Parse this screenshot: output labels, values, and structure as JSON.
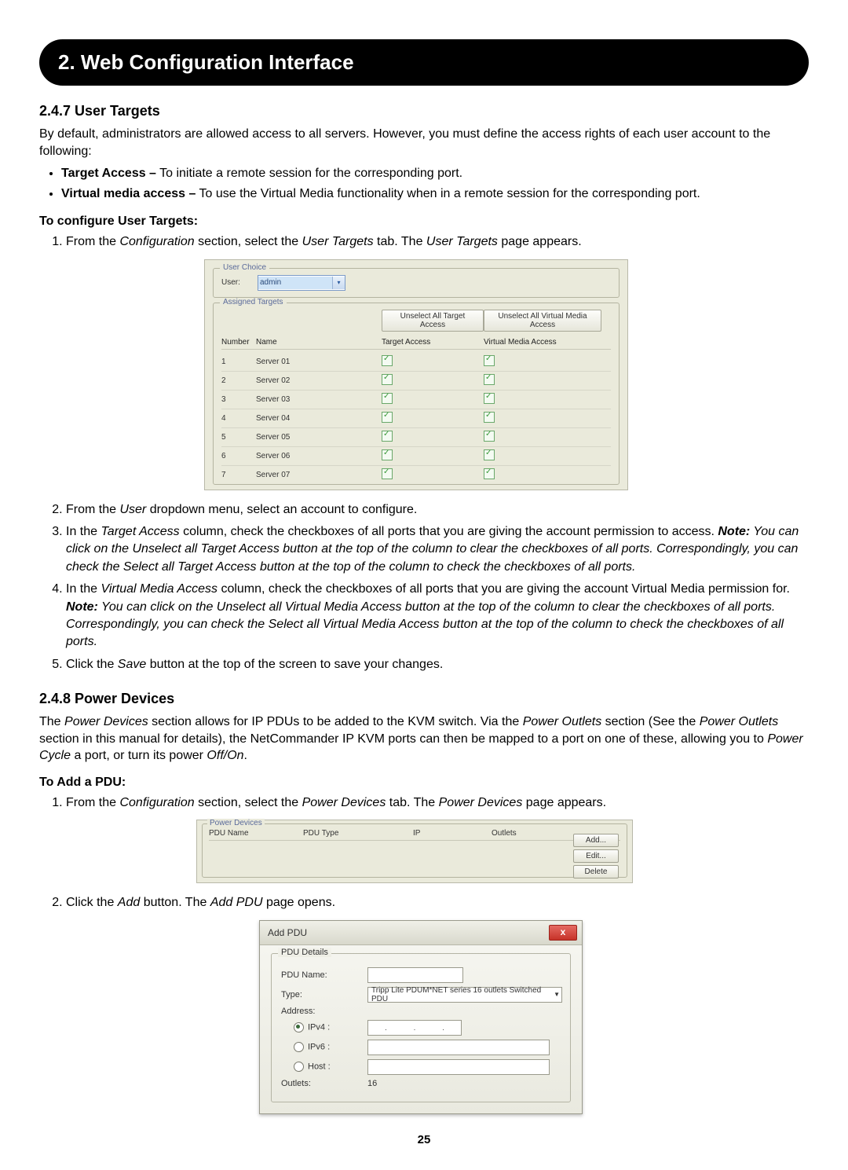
{
  "chapter_title": "2. Web Configuration Interface",
  "s247": {
    "heading": "2.4.7 User Targets",
    "intro": "By default, administrators are allowed access to all servers. However, you must define the access rights of each user account to the following:",
    "bullet1_bold": "Target Access –",
    "bullet1_text": " To initiate a remote session for the corresponding port.",
    "bullet2_bold": "Virtual media access –",
    "bullet2_text": " To use the Virtual Media functionality when in a remote session for the corresponding port.",
    "configure_head": "To configure User Targets:",
    "step1_a": "From the ",
    "step1_b": "Configuration",
    "step1_c": " section, select the ",
    "step1_d": "User Targets",
    "step1_e": " tab. The ",
    "step1_f": "User Targets",
    "step1_g": " page appears."
  },
  "ut_shot": {
    "user_choice_legend": "User Choice",
    "user_label": "User:",
    "user_value": "admin",
    "assigned_legend": "Assigned Targets",
    "btn_unselect_target": "Unselect All Target Access",
    "btn_unselect_virtual": "Unselect All Virtual Media Access",
    "col_number": "Number",
    "col_name": "Name",
    "col_target": "Target Access",
    "col_virtual": "Virtual Media Access",
    "rows": [
      {
        "num": "1",
        "name": "Server 01"
      },
      {
        "num": "2",
        "name": "Server 02"
      },
      {
        "num": "3",
        "name": "Server 03"
      },
      {
        "num": "4",
        "name": "Server 04"
      },
      {
        "num": "5",
        "name": "Server 05"
      },
      {
        "num": "6",
        "name": "Server 06"
      },
      {
        "num": "7",
        "name": "Server 07"
      }
    ]
  },
  "steps_after": {
    "s2_a": "From the ",
    "s2_b": "User",
    "s2_c": " dropdown menu, select an account to configure.",
    "s3_a": "In the ",
    "s3_b": "Target Access",
    "s3_c": " column, check the checkboxes of all ports that you are giving the account permission to access. ",
    "s3_note_b": "Note:",
    "s3_note": " You can click on the Unselect all Target Access button at the top of the column to clear the checkboxes of all ports. Correspondingly, you can check the Select all Target Access button at the top of the column to check the checkboxes of all ports.",
    "s4_a": "In the ",
    "s4_b": "Virtual Media Access",
    "s4_c": " column, check the checkboxes of all ports that you are giving the account Virtual Media permission for. ",
    "s4_note_b": "Note:",
    "s4_note": " You can click on the Unselect all Virtual Media Access button at the top of the column to clear the checkboxes of all ports. Correspondingly, you can check the Select all Virtual Media Access button at the top of the column to check the checkboxes of all ports.",
    "s5_a": "Click the ",
    "s5_b": "Save",
    "s5_c": " button at the top of the screen to save your changes."
  },
  "s248": {
    "heading": "2.4.8 Power Devices",
    "para_a": "The ",
    "para_b": "Power Devices",
    "para_c": " section allows for IP PDUs to be added to the KVM switch. Via the ",
    "para_d": "Power Outlets",
    "para_e": " section (See the ",
    "para_f": "Power Outlets",
    "para_g": " section in this manual for details), the NetCommander IP KVM ports can then be mapped to a port on one of these, allowing you to ",
    "para_h": "Power Cycle",
    "para_i": " a port, or turn its power ",
    "para_j": "Off/On",
    "para_k": ".",
    "add_head": "To Add a PDU:",
    "step1_a": "From the ",
    "step1_b": "Configuration",
    "step1_c": " section, select the ",
    "step1_d": "Power Devices",
    "step1_e": " tab. The ",
    "step1_f": "Power Devices",
    "step1_g": " page appears."
  },
  "pd_shot": {
    "legend": "Power Devices",
    "col_name": "PDU Name",
    "col_type": "PDU Type",
    "col_ip": "IP",
    "col_outlets": "Outlets",
    "btn_add": "Add...",
    "btn_edit": "Edit...",
    "btn_delete": "Delete"
  },
  "pd_step2_a": "Click the ",
  "pd_step2_b": "Add",
  "pd_step2_c": " button. The ",
  "pd_step2_d": "Add PDU",
  "pd_step2_e": " page opens.",
  "dlg": {
    "title": "Add PDU",
    "close": "x",
    "legend": "PDU Details",
    "pdu_name": "PDU Name:",
    "type": "Type:",
    "type_value": "Tripp Lite PDUM*NET series 16 outlets Switched PDU",
    "address": "Address:",
    "ipv4": "IPv4 :",
    "ipv6": "IPv6 :",
    "host": "Host :",
    "outlets": "Outlets:",
    "outlets_value": "16",
    "dot": "."
  },
  "page_number": "25"
}
